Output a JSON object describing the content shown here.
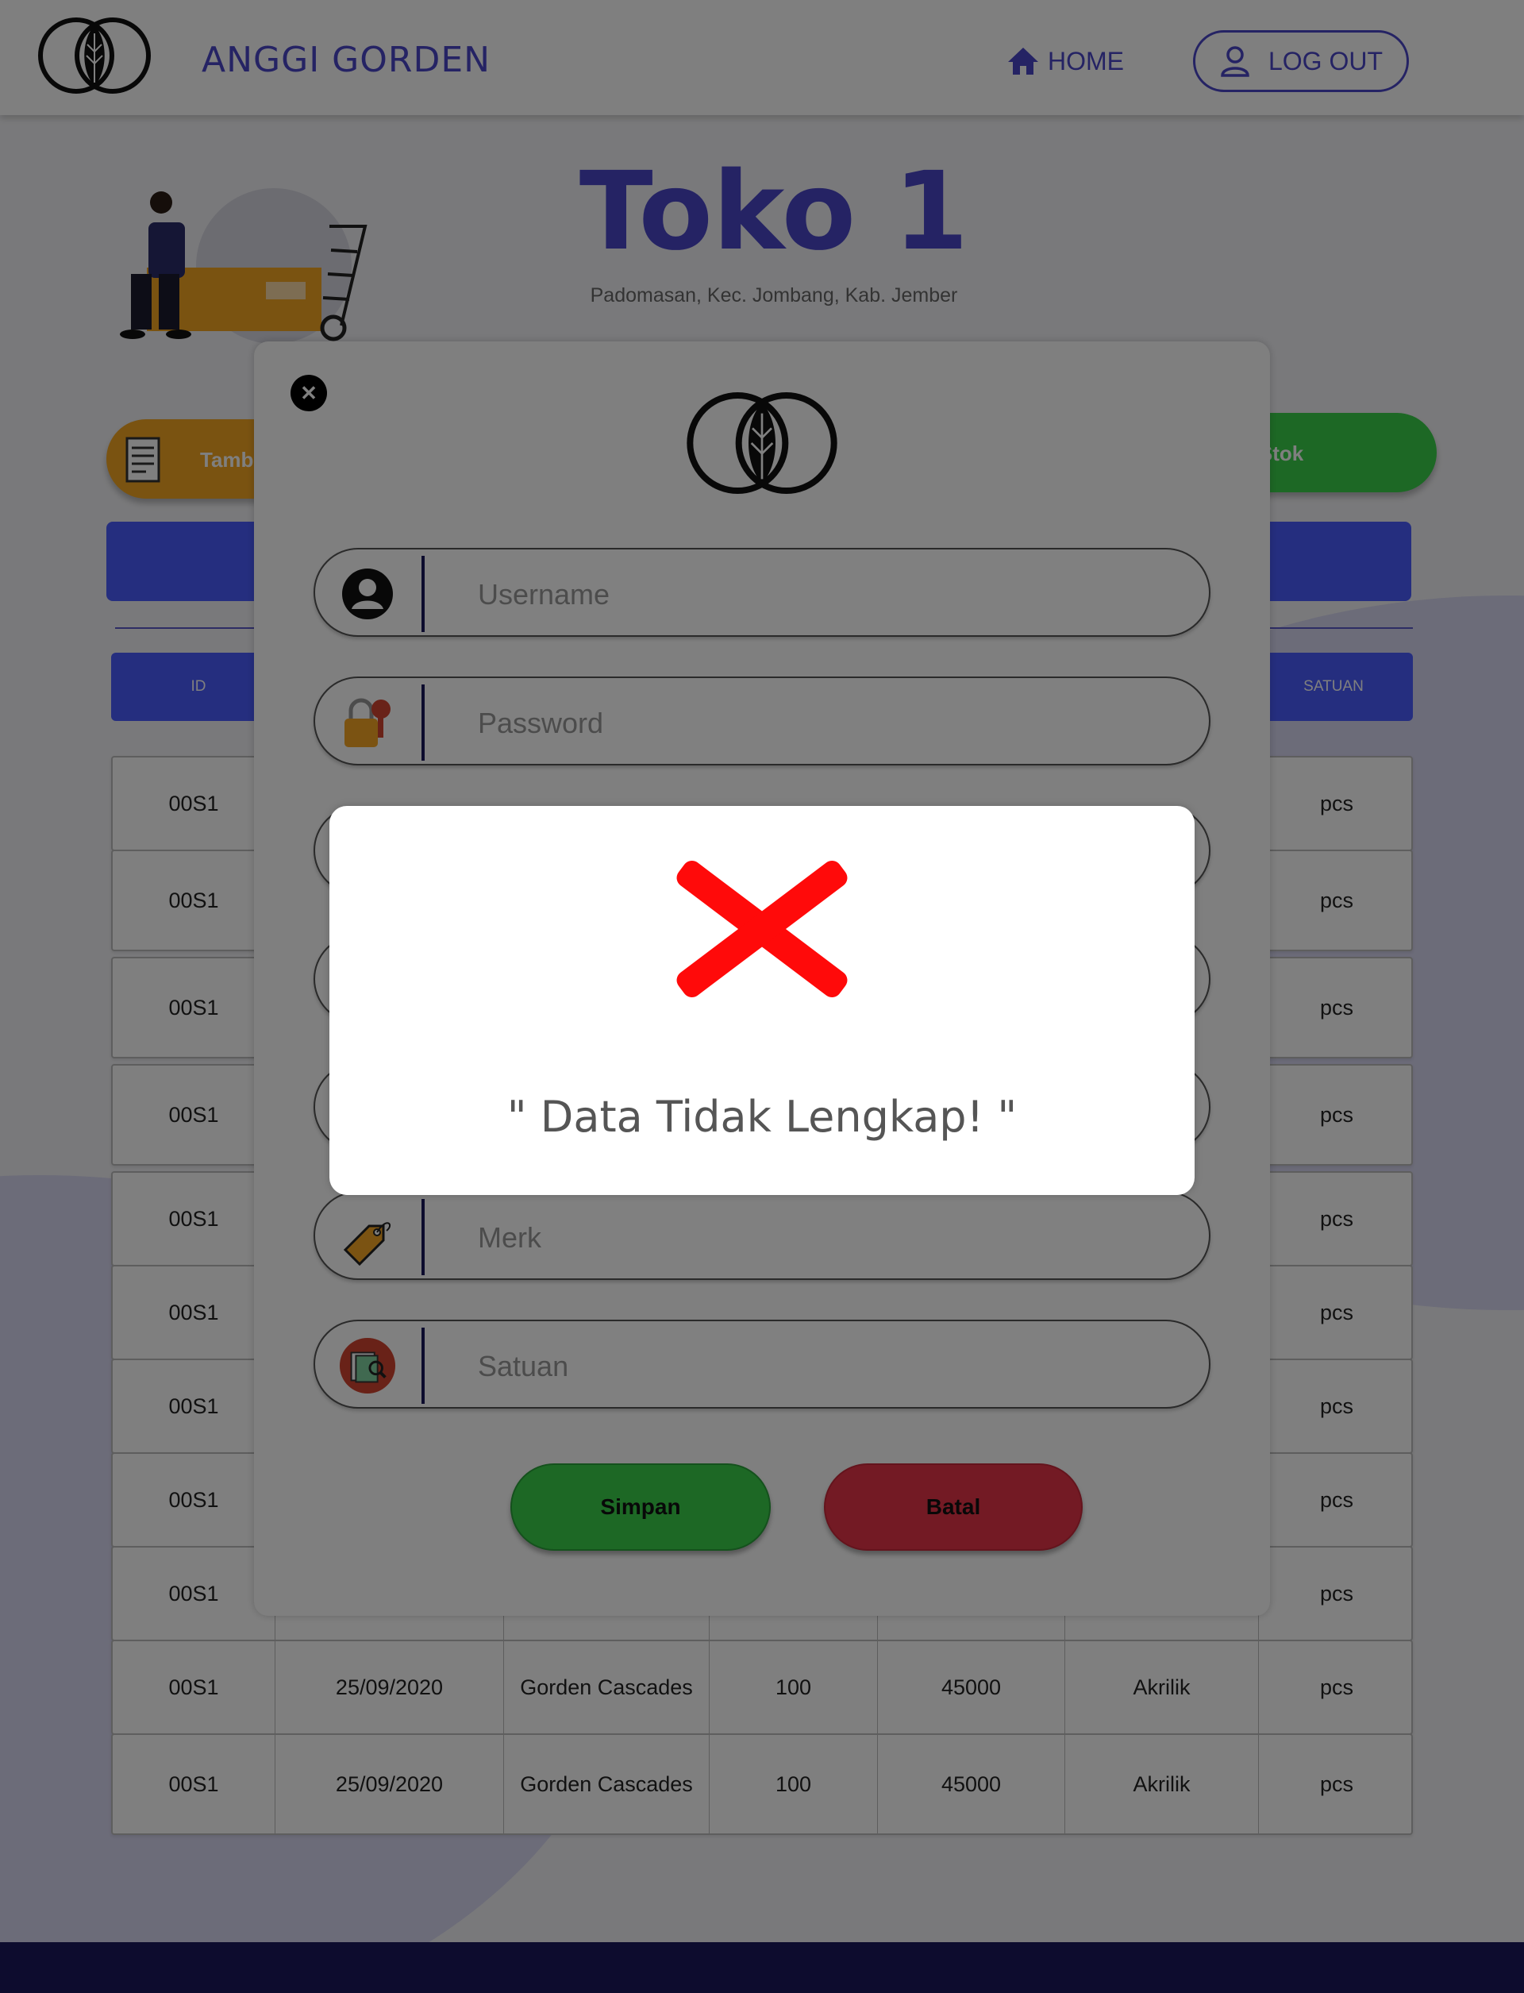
{
  "navbar": {
    "brand": "ANGGI GORDEN",
    "home_label": "HOME",
    "logout_label": "LOG OUT"
  },
  "store": {
    "title": "Toko 1",
    "address": "Padomasan, Kec. Jombang, Kab. Jember"
  },
  "actions": {
    "add_label": "Tamba",
    "stock_label": "t Stok"
  },
  "table": {
    "headers": [
      "ID",
      "SATUAN"
    ],
    "rows": [
      [
        "00S1",
        "",
        "",
        "",
        "",
        "",
        "pcs"
      ],
      [
        "00S1",
        "",
        "",
        "",
        "",
        "",
        "pcs"
      ],
      [
        "00S1",
        "",
        "",
        "",
        "",
        "",
        "pcs"
      ],
      [
        "00S1",
        "",
        "",
        "",
        "",
        "",
        "pcs"
      ],
      [
        "00S1",
        "",
        "",
        "",
        "",
        "",
        "pcs"
      ],
      [
        "00S1",
        "",
        "",
        "",
        "",
        "",
        "pcs"
      ],
      [
        "00S1",
        "",
        "",
        "",
        "",
        "",
        "pcs"
      ],
      [
        "00S1",
        "",
        "",
        "",
        "",
        "",
        "pcs"
      ],
      [
        "00S1",
        "",
        "",
        "",
        "",
        "",
        "pcs"
      ],
      [
        "00S1",
        "25/09/2020",
        "Gorden Cascades",
        "100",
        "45000",
        "Akrilik",
        "pcs"
      ],
      [
        "00S1",
        "25/09/2020",
        "Gorden Cascades",
        "100",
        "45000",
        "Akrilik",
        "pcs"
      ]
    ]
  },
  "form": {
    "close_icon": "close-icon",
    "fields": [
      {
        "placeholder": "Username",
        "icon": "user-icon"
      },
      {
        "placeholder": "Password",
        "icon": "key-lock-icon"
      },
      {
        "placeholder": "",
        "icon": ""
      },
      {
        "placeholder": "",
        "icon": ""
      },
      {
        "placeholder": "",
        "icon": ""
      },
      {
        "placeholder": "Merk",
        "icon": "price-tag-icon"
      },
      {
        "placeholder": "Satuan",
        "icon": "document-search-icon"
      }
    ],
    "save_label": "Simpan",
    "cancel_label": "Batal"
  },
  "alert": {
    "icon": "error-x-icon",
    "message": "\" Data Tidak Lengkap! \""
  },
  "colors": {
    "brand": "#4a47c8",
    "add_button": "#f5a623",
    "stock_button": "#3ad04a",
    "table_header": "#4a5cff",
    "save": "#3ad04a",
    "cancel": "#e63347",
    "error": "#ff0000",
    "footer": "#1a185c"
  }
}
